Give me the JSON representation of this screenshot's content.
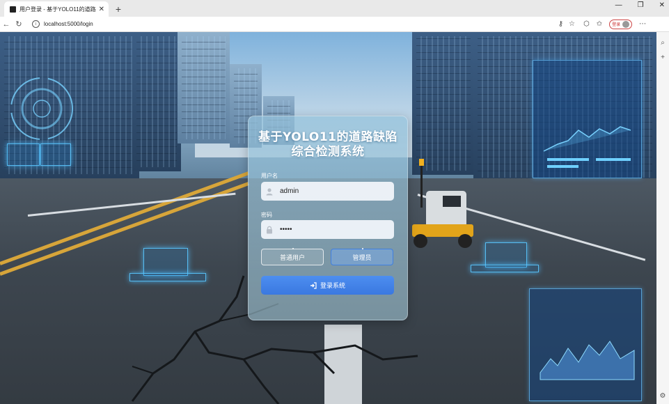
{
  "browser": {
    "tab_title": "用户登录 - 基于YOLO11的道路缺陷",
    "tab_close": "✕",
    "new_tab": "+",
    "url": "localhost:5000/login",
    "profile_label": "登录"
  },
  "login": {
    "title_line1": "基于YOLO11的道路缺陷",
    "title_line2": "综合检测系统",
    "username_label": "用户名",
    "username_value": "admin",
    "password_label": "密码",
    "password_value": "•••••",
    "role_user": "普通用户",
    "role_admin": "管理员",
    "selected_role": "管理员",
    "submit": "登录系统"
  },
  "colors": {
    "accent": "#3a78e0",
    "lane_yellow": "#d7a53a",
    "hologram": "#5ac8ff"
  }
}
